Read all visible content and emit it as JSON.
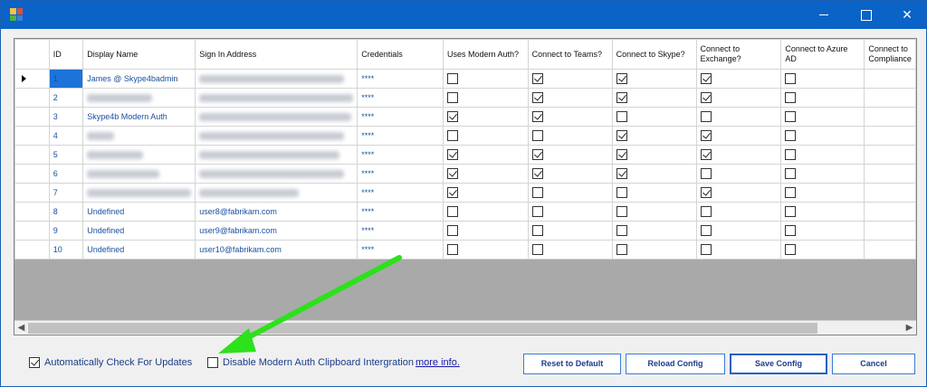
{
  "window": {
    "icon": "app-grid-icon",
    "controls": {
      "minimize": "minimize-icon",
      "maximize": "maximize-icon",
      "close": "✕"
    }
  },
  "grid": {
    "columns": [
      {
        "label": "ID",
        "width": 39
      },
      {
        "label": "Display Name",
        "width": 118
      },
      {
        "label": "Sign In Address",
        "width": 178
      },
      {
        "label": "Credentials",
        "width": 98
      },
      {
        "label": "Uses Modern Auth?",
        "width": 98
      },
      {
        "label": "Connect to Teams?",
        "width": 97
      },
      {
        "label": "Connect to Skype?",
        "width": 97
      },
      {
        "label": "Connect to Exchange?",
        "width": 97
      },
      {
        "label": "Connect to Azure AD",
        "width": 96
      },
      {
        "label": "Connect to Compliance",
        "width": 40
      }
    ],
    "rows": [
      {
        "id": "1",
        "display": "James @ Skype4badmin",
        "email": "",
        "cred": "****",
        "checks": [
          false,
          true,
          true,
          true,
          false
        ],
        "selected": true
      },
      {
        "id": "2",
        "display": "",
        "email": "",
        "cred": "****",
        "checks": [
          false,
          true,
          true,
          true,
          false
        ]
      },
      {
        "id": "3",
        "display": "Skype4b Modern Auth",
        "email": "",
        "cred": "****",
        "checks": [
          true,
          true,
          false,
          false,
          false
        ]
      },
      {
        "id": "4",
        "display": "",
        "email": "",
        "cred": "****",
        "checks": [
          false,
          false,
          true,
          true,
          false
        ]
      },
      {
        "id": "5",
        "display": "",
        "email": "",
        "cred": "****",
        "checks": [
          true,
          true,
          true,
          true,
          false
        ]
      },
      {
        "id": "6",
        "display": "",
        "email": "",
        "cred": "****",
        "checks": [
          true,
          true,
          true,
          false,
          false
        ]
      },
      {
        "id": "7",
        "display": "",
        "email": "",
        "cred": "****",
        "checks": [
          true,
          false,
          false,
          true,
          false
        ]
      },
      {
        "id": "8",
        "display": "Undefined",
        "email": "user8@fabrikam.com",
        "cred": "****",
        "checks": [
          false,
          false,
          false,
          false,
          false
        ]
      },
      {
        "id": "9",
        "display": "Undefined",
        "email": "user9@fabrikam.com",
        "cred": "****",
        "checks": [
          false,
          false,
          false,
          false,
          false
        ]
      },
      {
        "id": "10",
        "display": "Undefined",
        "email": "user10@fabrikam.com",
        "cred": "****",
        "checks": [
          false,
          false,
          false,
          false,
          false
        ]
      }
    ]
  },
  "options": {
    "auto_update_label": "Automatically Check For Updates",
    "auto_update_checked": true,
    "clipboard_label": "Disable Modern Auth Clipboard Intergration",
    "clipboard_checked": false,
    "more_info": "more info."
  },
  "buttons": {
    "reset": "Reset to Default",
    "reload": "Reload Config",
    "save": "Save Config",
    "cancel": "Cancel"
  },
  "colors": {
    "accent": "#0a63c7",
    "selection": "#1c73d9",
    "arrow": "#2de11c"
  }
}
